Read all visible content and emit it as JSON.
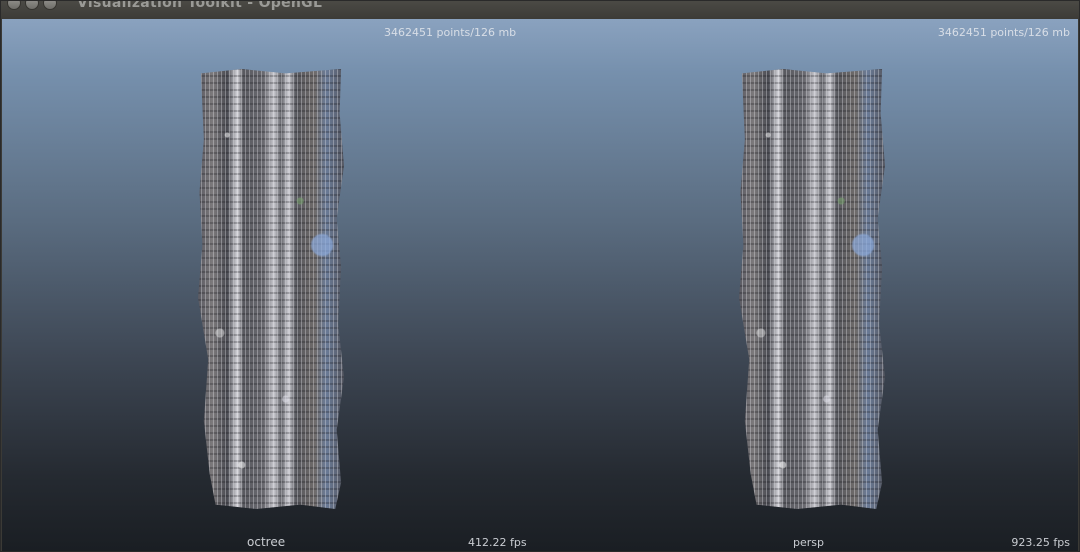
{
  "window": {
    "title": "Visualization Toolkit - OpenGL"
  },
  "viewports": {
    "left": {
      "point_info": "3462451 points/126 mb",
      "label": "octree",
      "fps": "412.22 fps"
    },
    "right": {
      "point_info": "3462451 points/126 mb",
      "label": "persp",
      "fps": "923.25 fps"
    }
  },
  "icons": {
    "close": "close-icon",
    "minimize": "minimize-icon",
    "maximize": "maximize-icon"
  },
  "colors": {
    "titlebar": "#3c3b37",
    "background_top": "#8aa2bf",
    "background_bottom": "#1a1e23",
    "hud_text": "#e6e9ee"
  }
}
